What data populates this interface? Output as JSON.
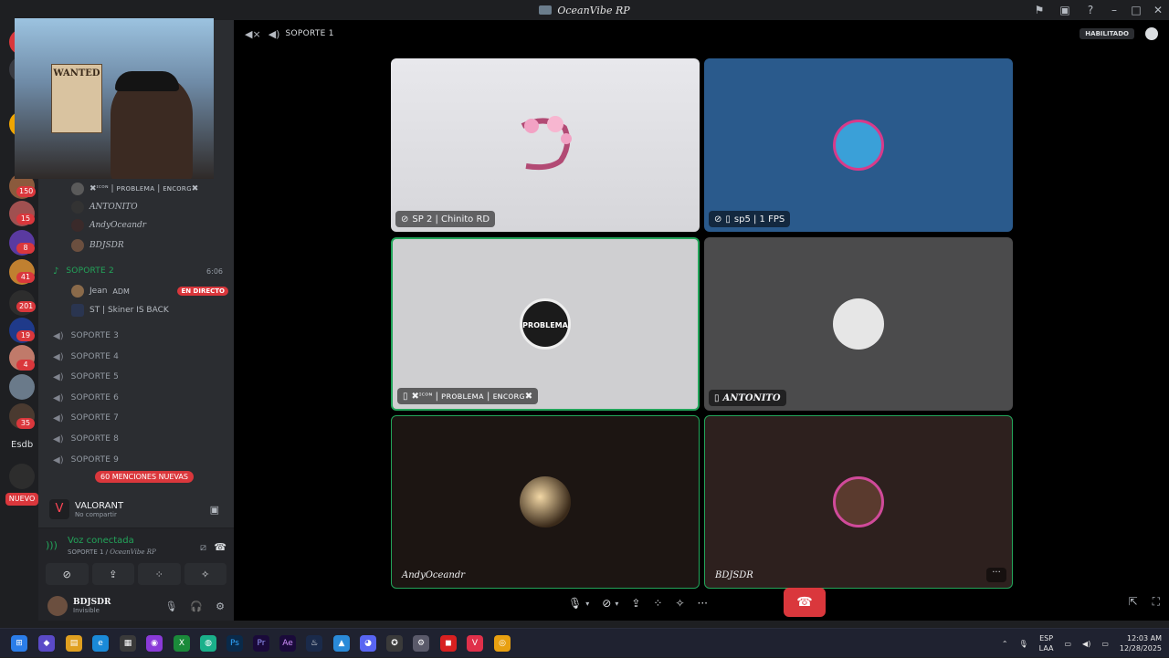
{
  "window": {
    "title": "OceanVibe RP"
  },
  "servers": {
    "badges": [
      "150",
      "15",
      "8",
      "41",
      "201",
      "19",
      "4",
      "35"
    ],
    "text_item": "Esdb",
    "new_label": "NUEVO"
  },
  "sidebar": {
    "voice_users_top": [
      {
        "name": "✖ᶦᶜᵒᶰ | ᴘʀᴏʙʟᴇᴍᴀ | ᴇɴᴄᴏʀɢ✖"
      },
      {
        "name": "ANTONITO"
      },
      {
        "name": "AndyOceandr"
      },
      {
        "name": "BDJSDR"
      }
    ],
    "channels": {
      "soporte2": {
        "name": "SOPORTE 2",
        "time": "6:06"
      },
      "soporte2_users": [
        {
          "name": "Jean",
          "role": "ADM",
          "live": "EN DIRECTO"
        },
        {
          "name": "ST | Skiner IS BACK"
        }
      ],
      "list": [
        "SOPORTE 3",
        "SOPORTE 4",
        "SOPORTE 5",
        "SOPORTE 6",
        "SOPORTE 7",
        "SOPORTE 8",
        "SOPORTE 9"
      ],
      "mentions": "60 MENCIONES NUEVAS"
    },
    "activity": {
      "game": "VALORANT",
      "status": "No compartir"
    },
    "voice": {
      "status": "Voz conectada",
      "channel": "SOPORTE 1",
      "server": "OceanVibe RP"
    },
    "user": {
      "name": "BDJSDR",
      "status": "Invisible"
    }
  },
  "stage": {
    "channel_name": "SOPORTE 1",
    "habilitado": "HABILITADO",
    "tiles": [
      {
        "label": "SP 2 | Chinito RD"
      },
      {
        "label": "sp5 | 1 FPS"
      },
      {
        "label": "✖ᶦᶜᵒᶰ | ᴘʀᴏʙʟᴇᴍᴀ | ᴇɴᴄᴏʀɢ✖",
        "logo_text": "PROBLEMA"
      },
      {
        "label": "ANTONITO"
      },
      {
        "label": "AndyOceandr"
      },
      {
        "label": "BDJSDR"
      }
    ],
    "colors": {
      "accent_green": "#23a55a",
      "danger": "#da373c"
    }
  },
  "taskbar": {
    "lang": [
      "ESP",
      "LAA"
    ],
    "time": "12:03 AM",
    "date": "12/28/2025"
  },
  "webcam": {
    "poster_text": "WANTED"
  }
}
